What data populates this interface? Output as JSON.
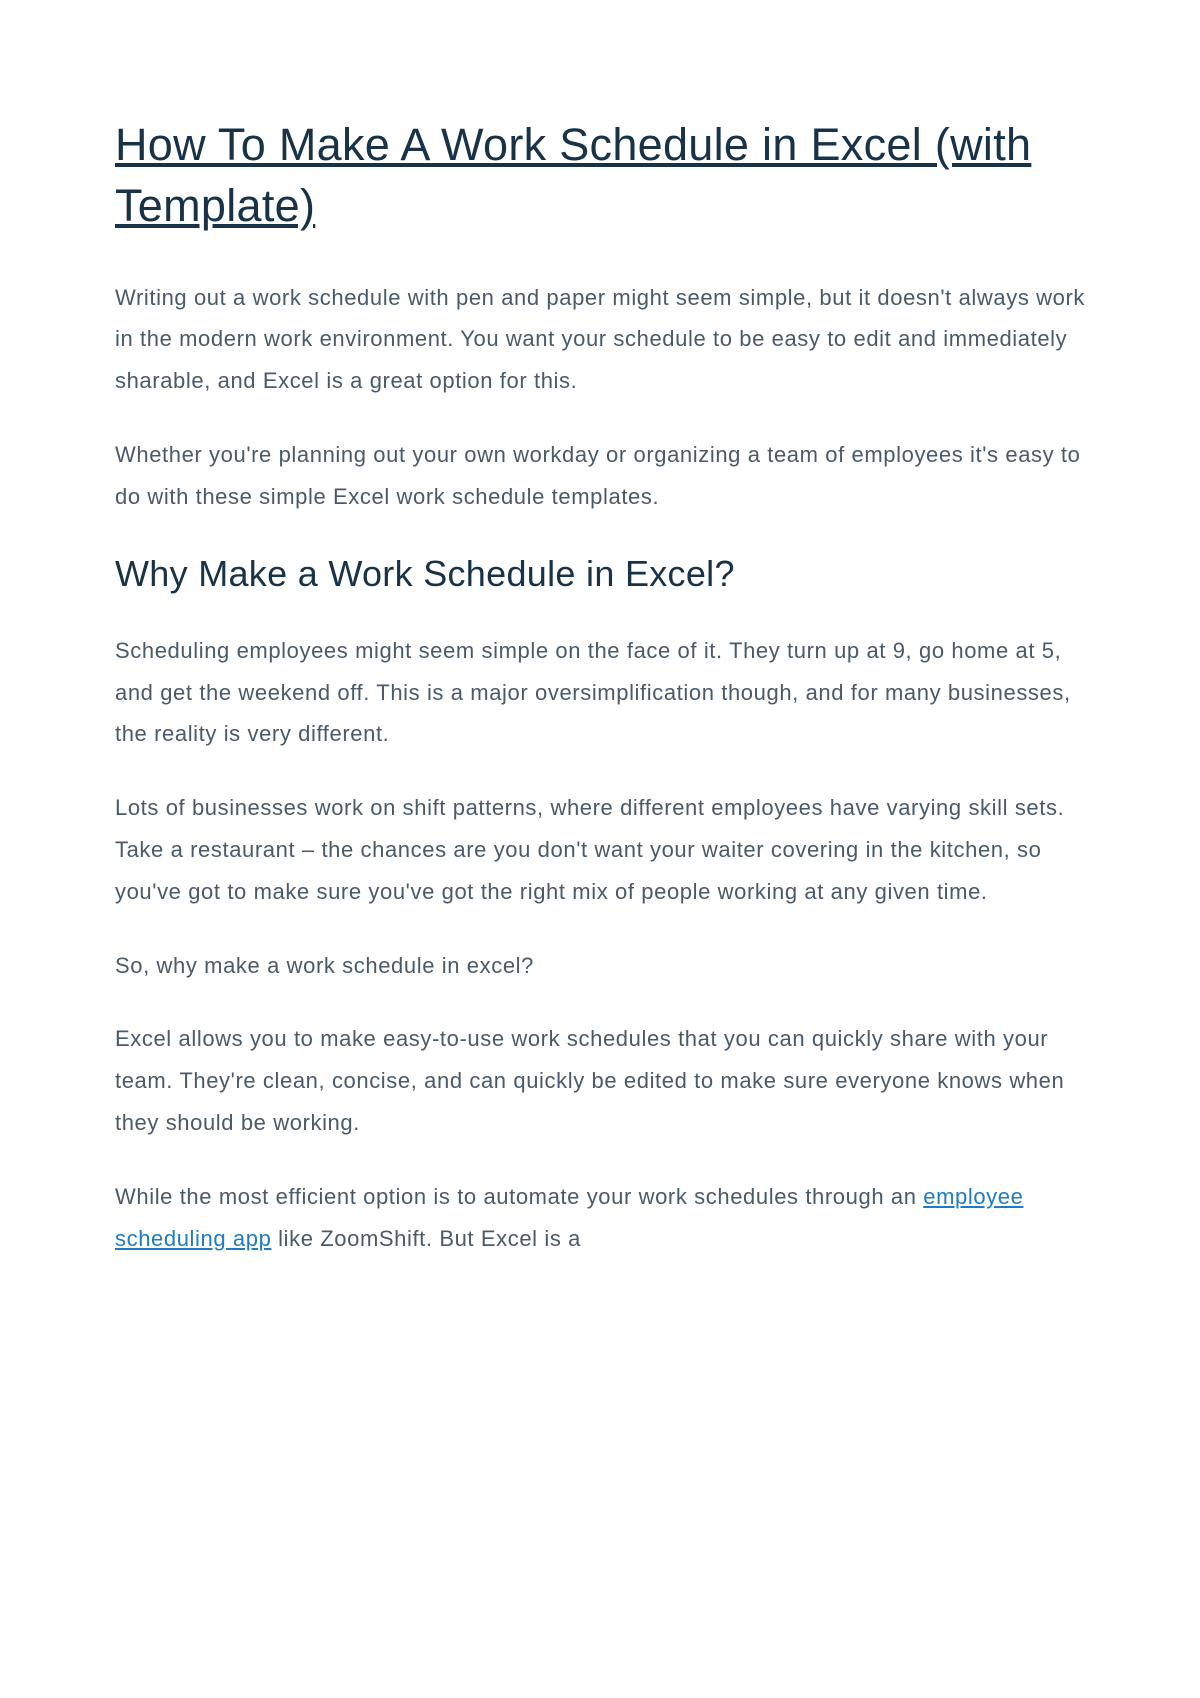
{
  "title": "How To Make A Work Schedule in Excel (with Template)",
  "intro": {
    "p1": "Writing out a work schedule with pen and paper might seem simple, but it doesn't always work in the modern work environment. You want your schedule to be easy to edit and immediately sharable, and Excel is a great option for this.",
    "p2": "Whether you're planning out your own workday or organizing a team of employees it's easy to do with these simple Excel work schedule templates."
  },
  "section1": {
    "heading": "Why Make a Work Schedule in Excel?",
    "p1": "Scheduling employees might seem simple on the face of it. They turn up at 9, go home at 5, and get the weekend off. This is a major oversimplification though, and for many businesses, the reality is very different.",
    "p2": "Lots of businesses work on shift patterns, where different employees have varying skill sets. Take a restaurant – the chances are you don't want your waiter covering in the kitchen, so you've got to make sure you've got the right mix of people working at any given time.",
    "p3": "So, why make a work schedule in excel?",
    "p4": "Excel allows you to make easy-to-use work schedules that you can quickly share with your team. They're clean, concise, and can quickly be edited to make sure everyone knows when they should be working.",
    "p5_before": "While the most efficient option is to automate your work schedules through an ",
    "p5_link": "employee scheduling app",
    "p5_after": " like ZoomShift. But Excel is a"
  }
}
